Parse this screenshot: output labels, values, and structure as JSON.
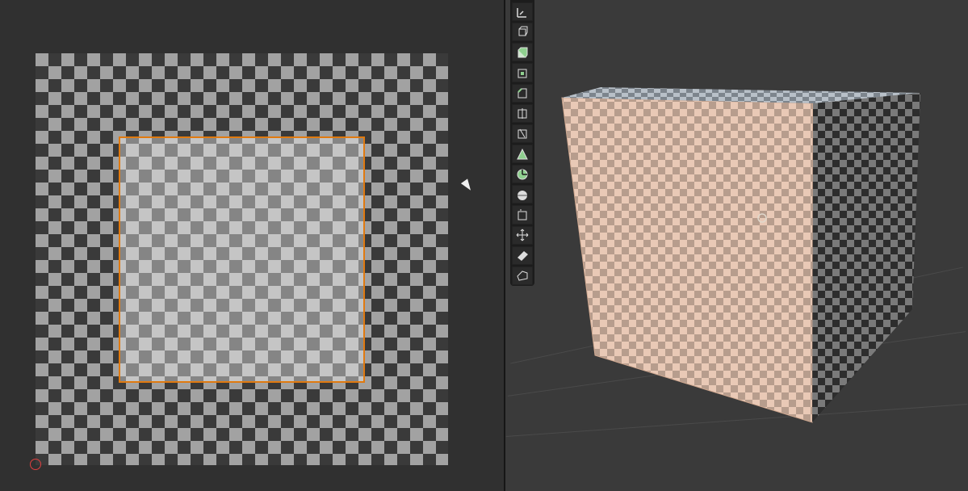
{
  "uv_editor": {
    "texture": "uv-grid",
    "selected_face_outline_color": "#e07a10",
    "checker_dark": "#3f3f3f",
    "checker_light": "#cfcfcf"
  },
  "viewport_3d": {
    "object": "cube",
    "face_tint_color": "#e9c9b6",
    "dark_face_color": "#2d2d2d"
  },
  "toolbar": {
    "tools": [
      {
        "name": "measure-icon",
        "active": false
      },
      {
        "name": "add-cube-icon",
        "active": false
      },
      {
        "name": "extrude-region-icon",
        "active": false
      },
      {
        "name": "inset-faces-icon",
        "active": false
      },
      {
        "name": "bevel-icon",
        "active": false
      },
      {
        "name": "loop-cut-icon",
        "active": false
      },
      {
        "name": "knife-icon",
        "active": false
      },
      {
        "name": "poly-build-icon",
        "active": false
      },
      {
        "name": "spin-icon",
        "active": false
      },
      {
        "name": "smooth-icon",
        "active": false
      },
      {
        "name": "edge-slide-icon",
        "active": false
      },
      {
        "name": "shrink-fatten-icon",
        "active": false
      },
      {
        "name": "shear-icon",
        "active": false
      },
      {
        "name": "rip-region-icon",
        "active": false
      }
    ]
  }
}
